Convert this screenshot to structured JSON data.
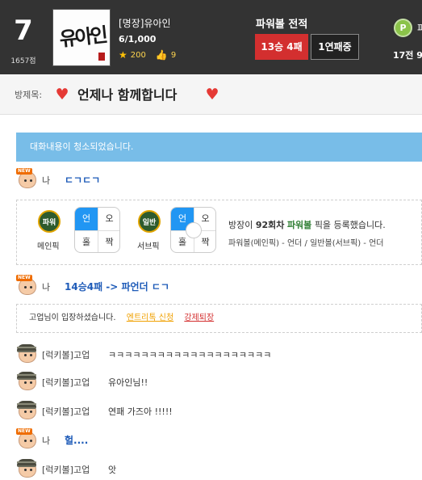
{
  "header": {
    "rank": "7",
    "rank_points": "1657점",
    "avatar_text": "유아인",
    "user_name": "[명장]유아인",
    "exp": "6/1,000",
    "stars": "200",
    "likes": "9",
    "powerball_title": "파워볼 전적",
    "win_loss": "13승 4패",
    "streak": "1연패중",
    "p_icon": "P",
    "p_title": "파",
    "p_record": "17전 9"
  },
  "room": {
    "label": "방제목:",
    "title": "언제나 함께합니다"
  },
  "chat": {
    "notice": "대화내용이 청소되었습니다.",
    "messages": [
      {
        "name": "나",
        "text": "ㄷㄱㄷㄱ"
      },
      {
        "name": "나",
        "text": "14승4패 -> 파언더 ㄷㄱ"
      },
      {
        "name": "[럭키볼]고업",
        "text": "ㅋㅋㅋㅋㅋㅋㅋㅋㅋㅋㅋㅋㅋㅋㅋㅋㅋㅋㅋㅋ"
      },
      {
        "name": "[럭키볼]고업",
        "text": "유아인님!!"
      },
      {
        "name": "[럭키볼]고업",
        "text": "연패 가즈아 !!!!!"
      },
      {
        "name": "나",
        "text": "헐...."
      },
      {
        "name": "[럭키볼]고업",
        "text": "앗"
      }
    ],
    "pick": {
      "main_ball": "파워볼",
      "main_label": "메인픽",
      "sub_ball": "일반볼",
      "sub_label": "서브픽",
      "grid": [
        "언",
        "오",
        "홀",
        "짝"
      ],
      "desc_prefix": "방장이",
      "round": "92회차",
      "game": "파워볼",
      "desc_suffix": "픽을 등록했습니다.",
      "detail": "파워볼(메인픽) - 언더 / 일반볼(서브픽) - 언더"
    },
    "entry": {
      "user": "고업",
      "text": "님이 입장하셨습니다.",
      "apply": "엔트리톡 신청",
      "kick": "강제퇴장"
    }
  }
}
